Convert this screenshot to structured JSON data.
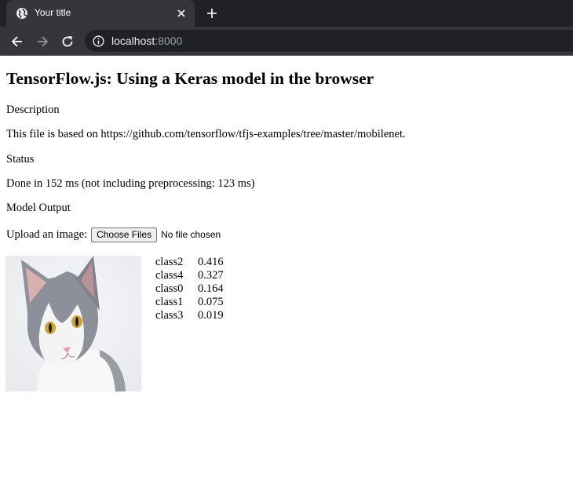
{
  "browser": {
    "tab_title": "Your title",
    "url_host": "localhost",
    "url_port": ":8000"
  },
  "page": {
    "heading": "TensorFlow.js: Using a Keras model in the browser",
    "description_label": "Description",
    "description_text": "This file is based on https://github.com/tensorflow/tfjs-examples/tree/master/mobilenet.",
    "status_label": "Status",
    "status_text": "Done in 152 ms (not including preprocessing: 123 ms)",
    "output_label": "Model Output",
    "upload_label": "Upload an image:",
    "choose_files_label": "Choose Files",
    "no_file_text": "No file chosen",
    "predictions": [
      {
        "class": "class2",
        "score": "0.416"
      },
      {
        "class": "class4",
        "score": "0.327"
      },
      {
        "class": "class0",
        "score": "0.164"
      },
      {
        "class": "class1",
        "score": "0.075"
      },
      {
        "class": "class3",
        "score": "0.019"
      }
    ]
  },
  "icons": {
    "tab": "globe-icon",
    "close": "close-icon",
    "new_tab": "plus-icon",
    "back": "back-arrow-icon",
    "forward": "forward-arrow-icon",
    "reload": "reload-icon",
    "site_info": "info-icon"
  },
  "colors": {
    "chrome_dark": "#202124",
    "chrome_tab": "#35363a",
    "chrome_text": "#e8eaed",
    "url_port": "#9aa0a6"
  }
}
